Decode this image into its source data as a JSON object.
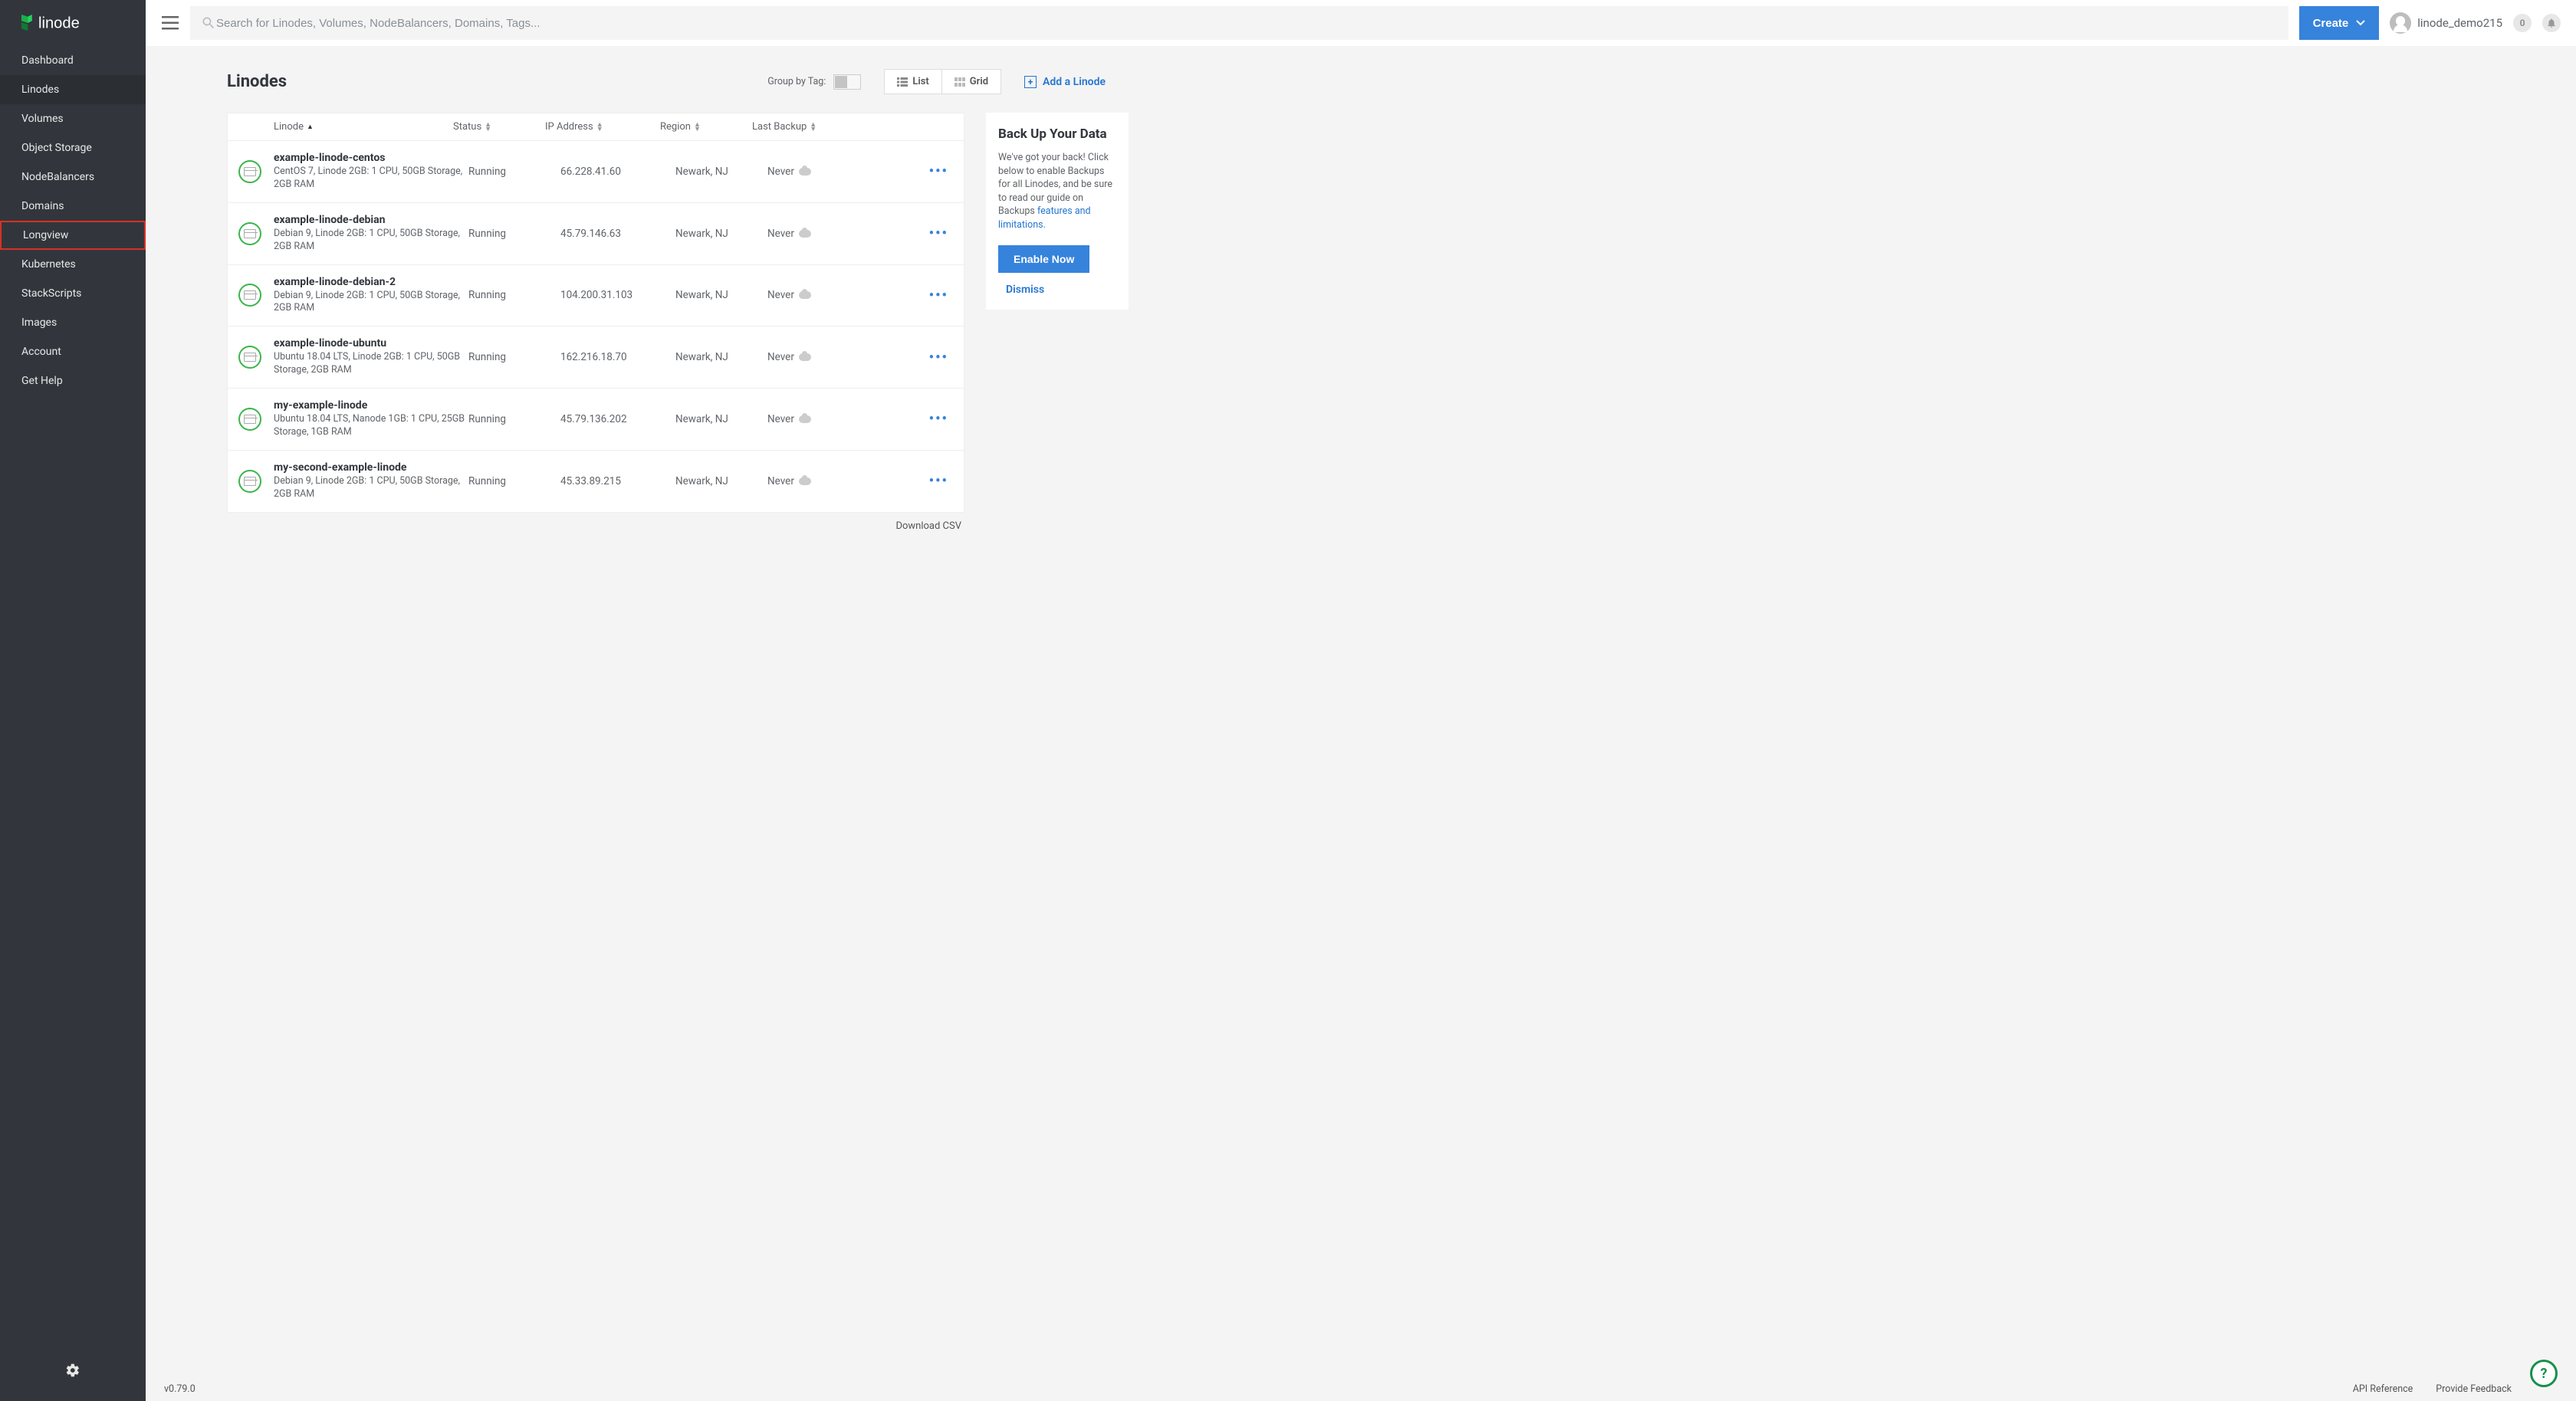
{
  "brand": "linode",
  "sidebar": {
    "items": [
      "Dashboard",
      "Linodes",
      "Volumes",
      "Object Storage",
      "NodeBalancers",
      "Domains",
      "Longview",
      "Kubernetes",
      "StackScripts",
      "Images",
      "Account",
      "Get Help"
    ],
    "active": "Linodes",
    "highlight": "Longview"
  },
  "header": {
    "searchPlaceholder": "Search for Linodes, Volumes, NodeBalancers, Domains, Tags...",
    "createLabel": "Create",
    "username": "linode_demo215",
    "notifCount": "0"
  },
  "page": {
    "title": "Linodes",
    "groupByLabel": "Group by Tag:",
    "viewList": "List",
    "viewGrid": "Grid",
    "addLabel": "Add a Linode",
    "downloadLabel": "Download CSV"
  },
  "columns": {
    "linode": "Linode",
    "status": "Status",
    "ip": "IP Address",
    "region": "Region",
    "backup": "Last Backup"
  },
  "rows": [
    {
      "name": "example-linode-centos",
      "spec": "CentOS 7, Linode 2GB: 1 CPU, 50GB Storage, 2GB RAM",
      "status": "Running",
      "ip": "66.228.41.60",
      "region": "Newark, NJ",
      "backup": "Never"
    },
    {
      "name": "example-linode-debian",
      "spec": "Debian 9, Linode 2GB: 1 CPU, 50GB Storage, 2GB RAM",
      "status": "Running",
      "ip": "45.79.146.63",
      "region": "Newark, NJ",
      "backup": "Never"
    },
    {
      "name": "example-linode-debian-2",
      "spec": "Debian 9, Linode 2GB: 1 CPU, 50GB Storage, 2GB RAM",
      "status": "Running",
      "ip": "104.200.31.103",
      "region": "Newark, NJ",
      "backup": "Never"
    },
    {
      "name": "example-linode-ubuntu",
      "spec": "Ubuntu 18.04 LTS, Linode 2GB: 1 CPU, 50GB Storage, 2GB RAM",
      "status": "Running",
      "ip": "162.216.18.70",
      "region": "Newark, NJ",
      "backup": "Never"
    },
    {
      "name": "my-example-linode",
      "spec": "Ubuntu 18.04 LTS, Nanode 1GB: 1 CPU, 25GB Storage, 1GB RAM",
      "status": "Running",
      "ip": "45.79.136.202",
      "region": "Newark, NJ",
      "backup": "Never"
    },
    {
      "name": "my-second-example-linode",
      "spec": "Debian 9, Linode 2GB: 1 CPU, 50GB Storage, 2GB RAM",
      "status": "Running",
      "ip": "45.33.89.215",
      "region": "Newark, NJ",
      "backup": "Never"
    }
  ],
  "backupCard": {
    "title": "Back Up Your Data",
    "text1": "We've got your back! Click below to enable Backups for all Linodes, and be sure to read our guide on Backups ",
    "link": "features and limitations.",
    "enable": "Enable Now",
    "dismiss": "Dismiss"
  },
  "footer": {
    "version": "v0.79.0",
    "api": "API Reference",
    "feedback": "Provide Feedback"
  }
}
